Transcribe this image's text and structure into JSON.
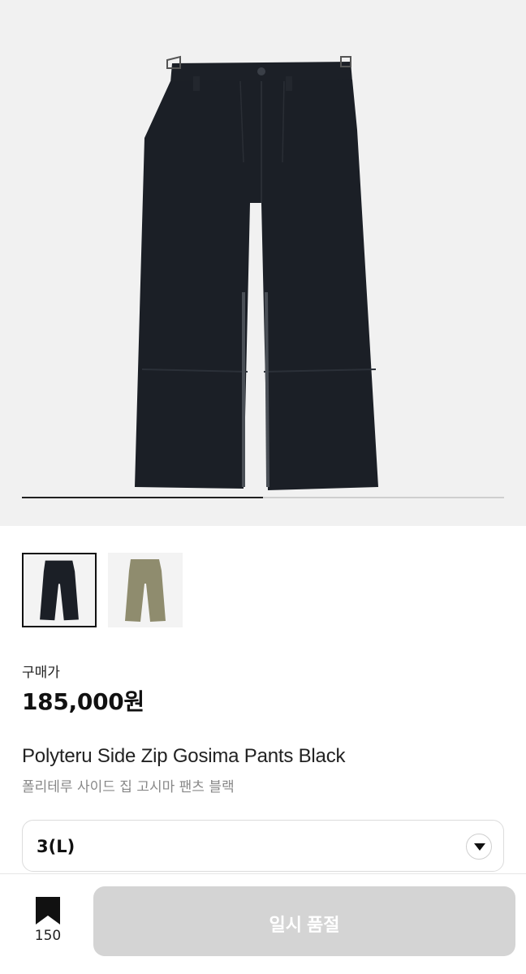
{
  "product": {
    "image_alt": "black pants",
    "price_label": "구매가",
    "price": "185,000원",
    "name_en": "Polyteru Side Zip Gosima Pants Black",
    "name_ko": "폴리테루 사이드 집 고시마 팬츠 블랙"
  },
  "gallery": {
    "progress": 0.5,
    "thumbnails": [
      {
        "color": "black",
        "selected": true
      },
      {
        "color": "khaki",
        "selected": false
      }
    ]
  },
  "options": {
    "size_selected": "3(L)"
  },
  "bottom_bar": {
    "bookmark_icon": "bookmark-icon",
    "bookmark_count": "150",
    "action_label": "일시 품절"
  },
  "colors": {
    "pants_black": "#1b1f26",
    "pants_khaki": "#8f8c6e",
    "disabled_button": "#d4d4d4"
  }
}
